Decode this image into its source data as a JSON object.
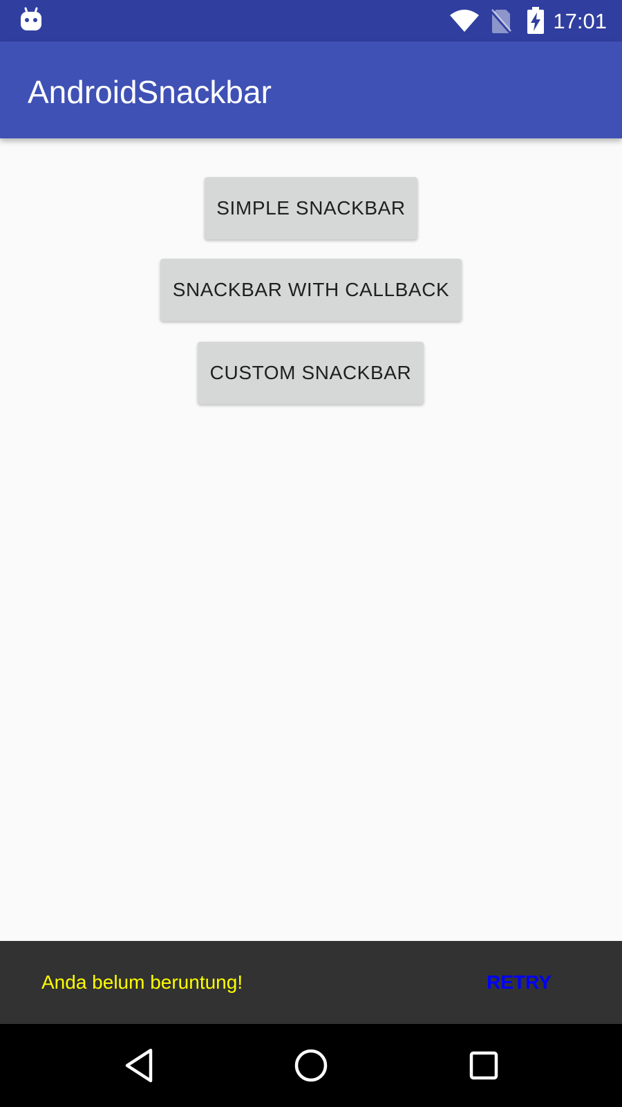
{
  "status_bar": {
    "time": "17:01",
    "icons": [
      "android-debug-icon",
      "wifi-icon",
      "no-sim-icon",
      "battery-charging-icon"
    ]
  },
  "app_bar": {
    "title": "AndroidSnackbar",
    "color": "#3f51b5",
    "status_color": "#303f9f"
  },
  "main": {
    "buttons": [
      {
        "label": "SIMPLE SNACKBAR"
      },
      {
        "label": "SNACKBAR WITH CALLBACK"
      },
      {
        "label": "CUSTOM SNACKBAR"
      }
    ]
  },
  "snackbar": {
    "message": "Anda belum beruntung!",
    "action": "RETRY",
    "message_color": "#ffff00",
    "action_color": "#0000ff",
    "background": "#323232"
  },
  "nav_bar": {
    "icons": [
      "back-icon",
      "home-icon",
      "recents-icon"
    ]
  }
}
